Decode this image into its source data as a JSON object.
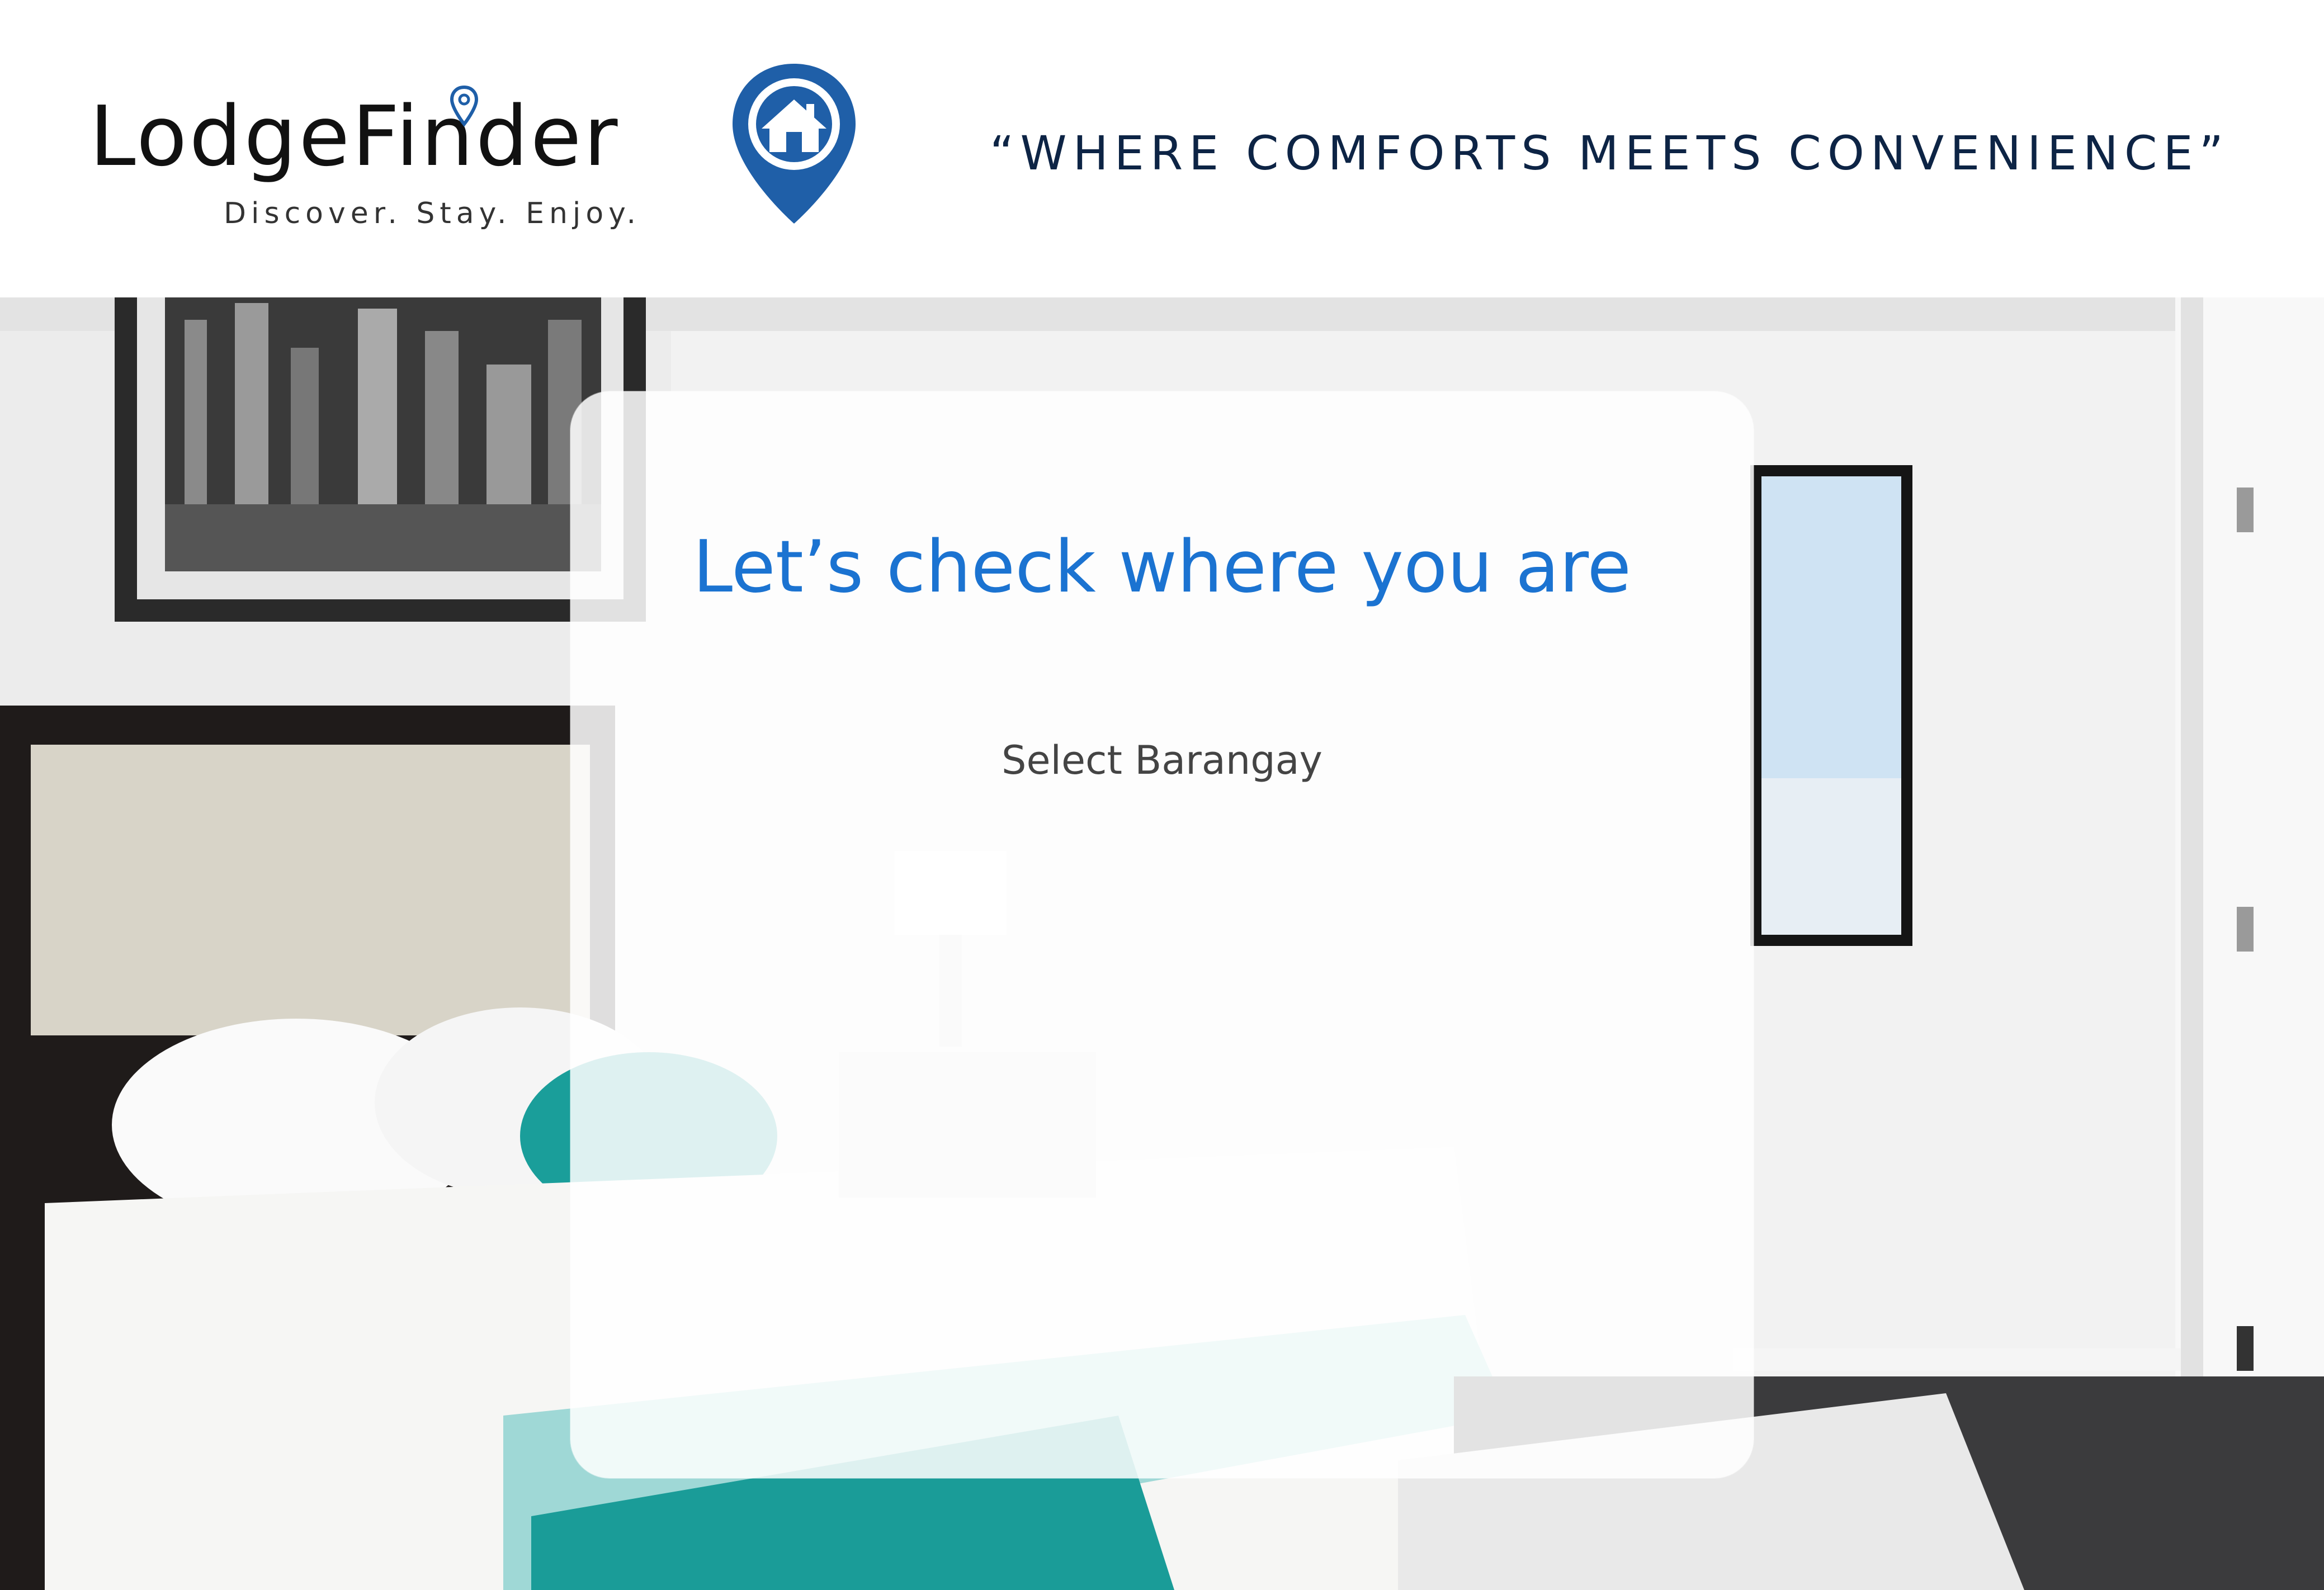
{
  "header": {
    "logo": {
      "wordmark": "LodgeFinder",
      "tagline": "Discover. Stay. Enjoy.",
      "brand_color": "#1f5fa8"
    },
    "slogan": "“WHERE COMFORTS MEETS CONVENIENCE”"
  },
  "hero": {
    "background": "bedroom-photo"
  },
  "card": {
    "title": "Let’s check where you are",
    "title_color": "#1b73d1",
    "barangay_select": {
      "selected": "Select Barangay",
      "options": [
        "Select Barangay"
      ]
    }
  }
}
